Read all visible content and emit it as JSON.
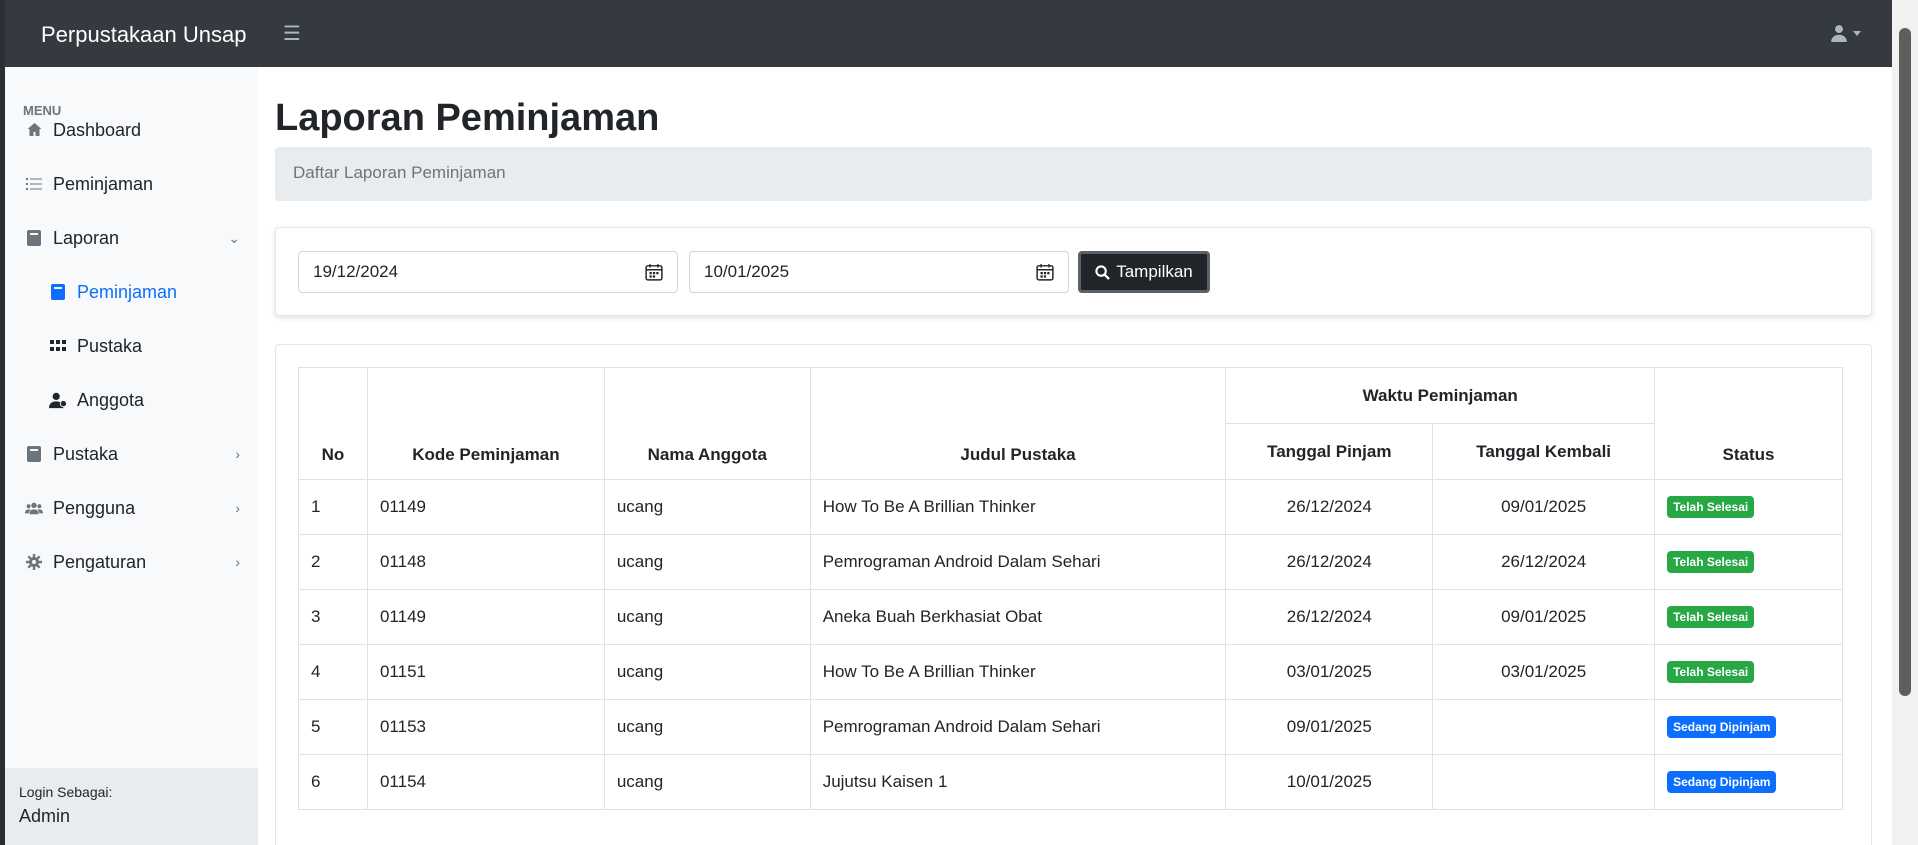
{
  "app": {
    "title": "Perpustakaan Unsap"
  },
  "sidebar": {
    "heading": "MENU",
    "items": [
      {
        "label": "Dashboard",
        "icon": "home-icon"
      },
      {
        "label": "Peminjaman",
        "icon": "list-icon"
      },
      {
        "label": "Laporan",
        "icon": "book-icon"
      },
      {
        "label": "Peminjaman",
        "icon": "book-icon"
      },
      {
        "label": "Pustaka",
        "icon": "grid-icon"
      },
      {
        "label": "Anggota",
        "icon": "user-icon"
      },
      {
        "label": "Pustaka",
        "icon": "book-icon"
      },
      {
        "label": "Pengguna",
        "icon": "users-icon"
      },
      {
        "label": "Pengaturan",
        "icon": "gear-icon"
      }
    ],
    "footer": {
      "label": "Login Sebagai:",
      "value": "Admin"
    }
  },
  "page": {
    "title": "Laporan Peminjaman",
    "breadcrumb": "Daftar Laporan Peminjaman"
  },
  "filter": {
    "start_date": "19/12/2024",
    "end_date": "10/01/2025",
    "button_label": "Tampilkan"
  },
  "table": {
    "headers": {
      "no": "No",
      "kode": "Kode Peminjaman",
      "nama": "Nama Anggota",
      "judul": "Judul Pustaka",
      "waktu": "Waktu Peminjaman",
      "pinjam": "Tanggal Pinjam",
      "kembali": "Tanggal Kembali",
      "status": "Status"
    },
    "rows": [
      {
        "no": "1",
        "kode": "01149",
        "nama": "ucang",
        "judul": "How To Be A Brillian Thinker",
        "pinjam": "26/12/2024",
        "kembali": "09/01/2025",
        "status": "Telah Selesai"
      },
      {
        "no": "2",
        "kode": "01148",
        "nama": "ucang",
        "judul": "Pemrograman Android Dalam Sehari",
        "pinjam": "26/12/2024",
        "kembali": "26/12/2024",
        "status": "Telah Selesai"
      },
      {
        "no": "3",
        "kode": "01149",
        "nama": "ucang",
        "judul": "Aneka Buah Berkhasiat Obat",
        "pinjam": "26/12/2024",
        "kembali": "09/01/2025",
        "status": "Telah Selesai"
      },
      {
        "no": "4",
        "kode": "01151",
        "nama": "ucang",
        "judul": "How To Be A Brillian Thinker",
        "pinjam": "03/01/2025",
        "kembali": "03/01/2025",
        "status": "Telah Selesai"
      },
      {
        "no": "5",
        "kode": "01153",
        "nama": "ucang",
        "judul": "Pemrograman Android Dalam Sehari",
        "pinjam": "09/01/2025",
        "kembali": "",
        "status": "Sedang Dipinjam"
      },
      {
        "no": "6",
        "kode": "01154",
        "nama": "ucang",
        "judul": "Jujutsu Kaisen 1",
        "pinjam": "10/01/2025",
        "kembali": "",
        "status": "Sedang Dipinjam"
      }
    ]
  },
  "colors": {
    "topbar": "#343a40",
    "accent": "#0d6efd",
    "success": "#28a745",
    "danger": "#dc3545"
  }
}
